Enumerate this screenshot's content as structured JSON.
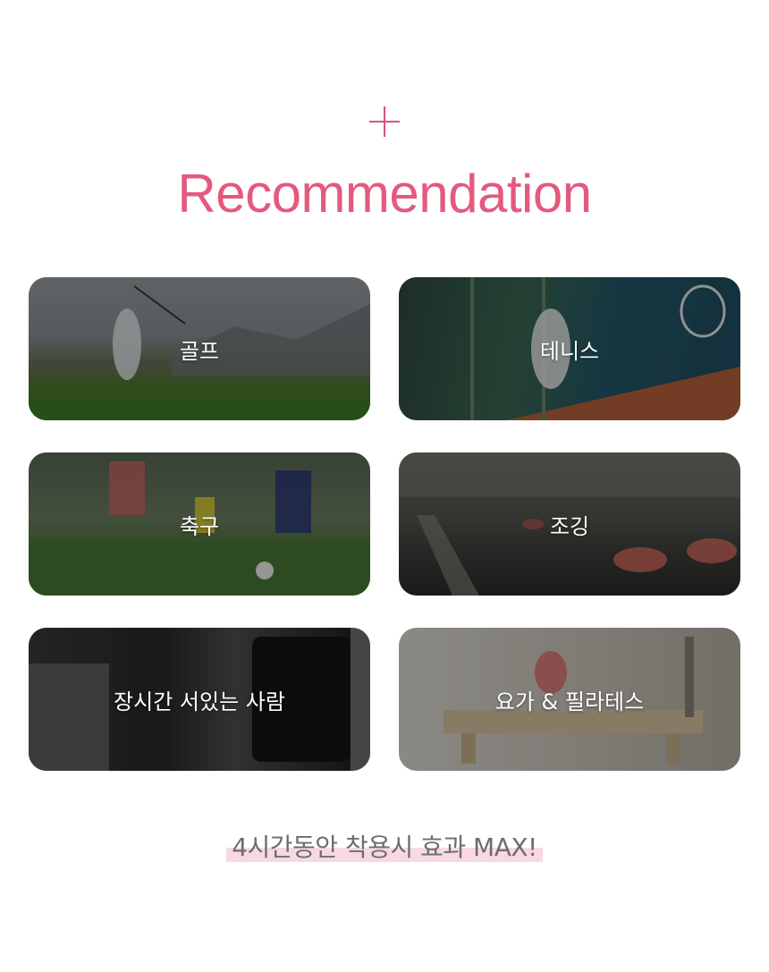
{
  "header": {
    "plus_icon": "plus-icon",
    "title": "Recommendation",
    "accent_color": "#e35a7e"
  },
  "cards": [
    {
      "label": "골프"
    },
    {
      "label": "테니스"
    },
    {
      "label": "축구"
    },
    {
      "label": "조깅"
    },
    {
      "label": "장시간 서있는 사람"
    },
    {
      "label": "요가 & 필라테스"
    }
  ],
  "footer": {
    "text": "4시간동안 착용시 효과 MAX!",
    "highlight_color": "#f8d9e2"
  }
}
